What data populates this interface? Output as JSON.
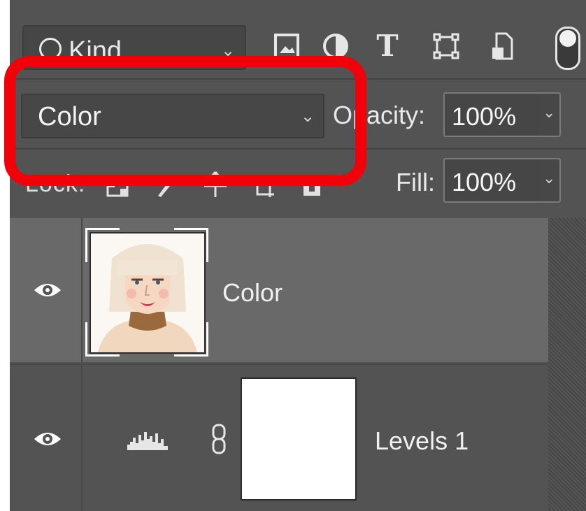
{
  "filter": {
    "kind_label": "Kind",
    "icons": [
      "image-filter-icon",
      "adjustment-filter-icon",
      "type-filter-icon",
      "shape-filter-icon",
      "smart-object-filter-icon"
    ],
    "type_glyph": "T"
  },
  "blend": {
    "mode_value": "Color",
    "opacity_label": "Opacity:",
    "opacity_value": "100%"
  },
  "lock": {
    "label": "Lock:",
    "fill_label": "Fill:",
    "fill_value": "100%"
  },
  "layers": [
    {
      "name": "Color",
      "visible": true,
      "selected": true,
      "thumbnail": "portrait-woman"
    },
    {
      "name": "Levels 1",
      "visible": true,
      "selected": false,
      "thumbnail": "white-mask",
      "adjustment_icon": "levels-histogram-icon"
    }
  ],
  "colors": {
    "panel": "#535353",
    "selected_row": "#696969",
    "highlight": "#f1000a"
  }
}
